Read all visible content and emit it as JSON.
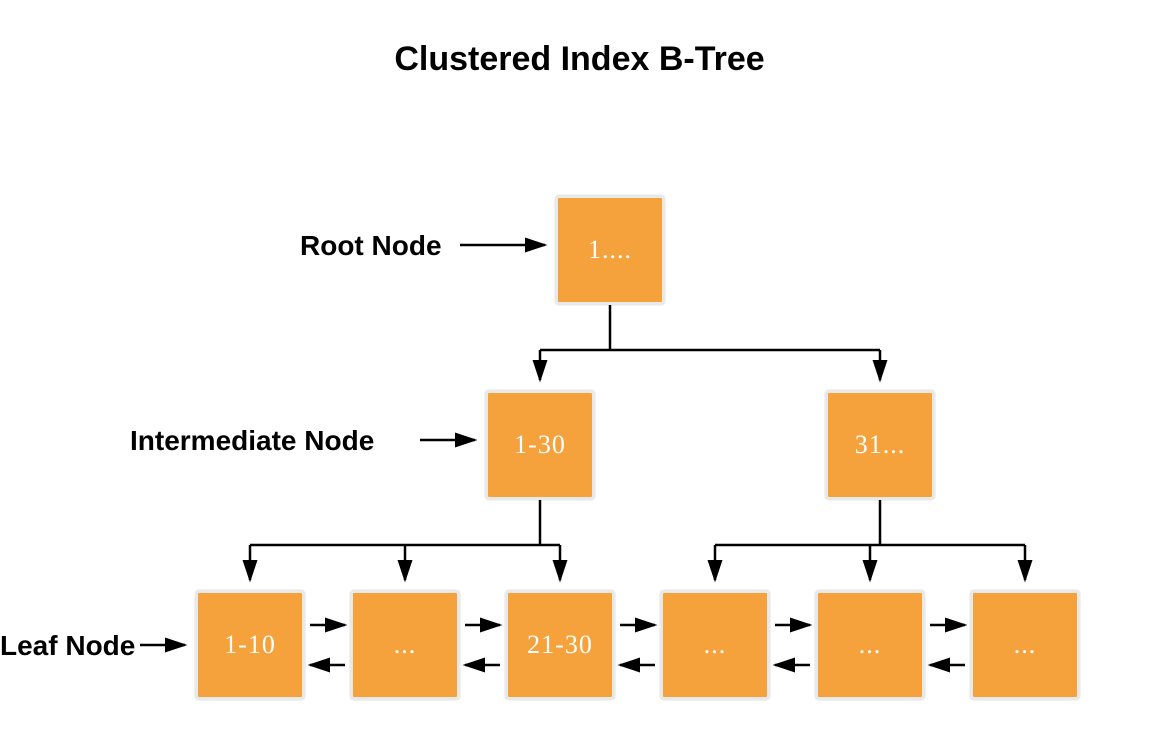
{
  "title": "Clustered Index B-Tree",
  "labels": {
    "root": "Root Node",
    "intermediate": "Intermediate Node",
    "leaf": "Leaf Node"
  },
  "nodes": {
    "root": "1....",
    "intermediate_left": "1-30",
    "intermediate_right": "31...",
    "leaf_1": "1-10",
    "leaf_2": "...",
    "leaf_3": "21-30",
    "leaf_4": "...",
    "leaf_5": "...",
    "leaf_6": "..."
  },
  "colors": {
    "node_bg": "#f5a23c",
    "node_border": "#e9e9e9",
    "node_text": "#ffffff",
    "arrow": "#000000"
  }
}
